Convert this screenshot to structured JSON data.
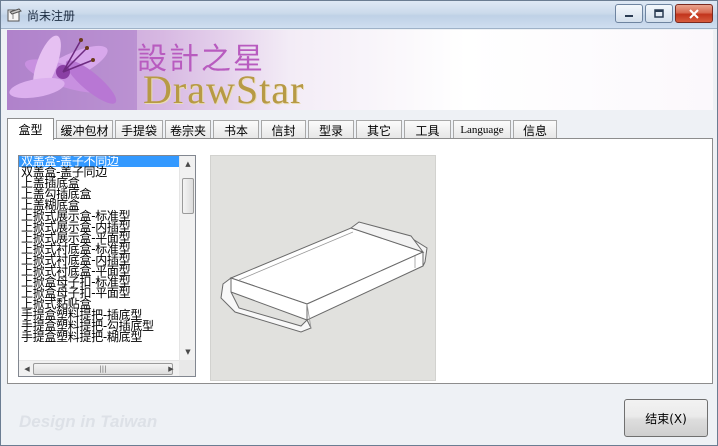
{
  "window": {
    "title": "尚未注册"
  },
  "banner": {
    "chinese_title": "設計之星",
    "logo_text": "DrawStar"
  },
  "tabs": [
    {
      "label": "盒型",
      "active": true
    },
    {
      "label": "缓冲包材",
      "active": false
    },
    {
      "label": "手提袋",
      "active": false
    },
    {
      "label": "卷宗夹",
      "active": false
    },
    {
      "label": "书本",
      "active": false
    },
    {
      "label": "信封",
      "active": false
    },
    {
      "label": "型录",
      "active": false
    },
    {
      "label": "其它",
      "active": false
    },
    {
      "label": "工具",
      "active": false
    },
    {
      "label": "Language",
      "active": false
    },
    {
      "label": "信息",
      "active": false
    }
  ],
  "box_list": {
    "selected_index": 0,
    "items": [
      "双盖盒-盖子不同边",
      "双盖盒-盖子同边",
      "上盖插底盒",
      "上盖勾插底盒",
      "上盖糊底盒",
      "上掀式展示盒-标准型",
      "上掀式展示盒-内插型",
      "上掀式展示盒-平面型",
      "上掀式衬底盒-标准型",
      "上掀式衬底盒-内插型",
      "上掀式衬底盒-平面型",
      "上掀盒母子扣-标准型",
      "上掀盒母子扣-平面型",
      "上掀式黏贴盒",
      "手提盒塑料提把-插底型",
      "手提盒塑料提把-勾插底型",
      "手提盒塑料提把-糊底型"
    ]
  },
  "preview": {
    "description_icon": "box-preview-drawing"
  },
  "footer": {
    "tagline": "Design in Taiwan",
    "end_button_label": "结束(X)"
  },
  "colors": {
    "selection": "#3399ff",
    "banner_title": "#b85bbf",
    "logo": "#b79a45",
    "close_button": "#c2341c"
  }
}
